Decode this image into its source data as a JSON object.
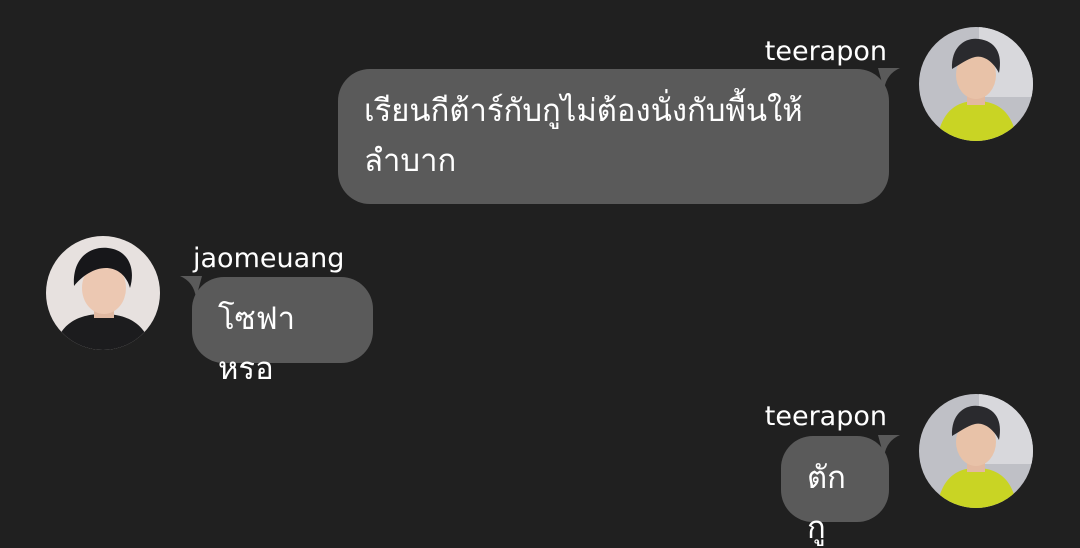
{
  "messages": [
    {
      "username": "teerapon",
      "text": "เรียนกีต้าร์กับกูไม่ต้องนั่งกับพื้นให้ลำบาก"
    },
    {
      "username": "jaomeuang",
      "text": "โซฟาหรอ"
    },
    {
      "username": "teerapon",
      "text": "ตักกู"
    }
  ],
  "colors": {
    "background": "#202020",
    "bubble": "#5a5a5a",
    "text": "#ffffff"
  }
}
